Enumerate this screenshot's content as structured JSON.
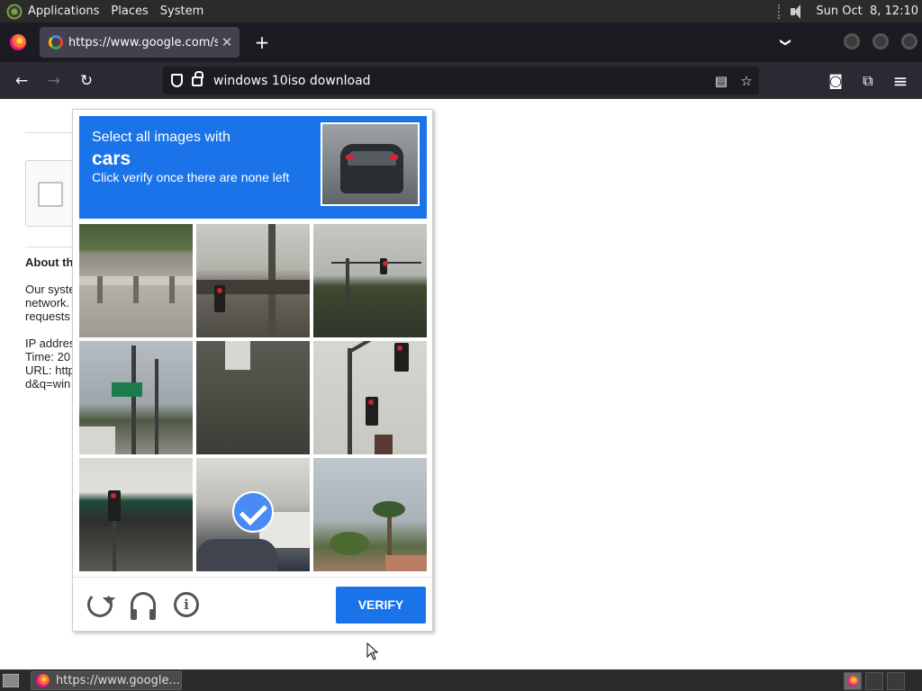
{
  "top_panel": {
    "menus": [
      "Applications",
      "Places",
      "System"
    ],
    "clock": "Sun Oct  8, 12:10"
  },
  "browser": {
    "tab_title": "https://www.google.com/se",
    "tab_close": "✕",
    "new_tab": "+",
    "tab_list": "❯",
    "url": "windows 10iso download",
    "icons": {
      "back": "←",
      "forward": "→",
      "reload": "↻",
      "reader": "▤",
      "star": "☆",
      "pocket": "◙",
      "extensions": "⧉",
      "menu": "≡"
    }
  },
  "page": {
    "about_heading": "About th",
    "body_lines": [
      "Our syste",
      "network.",
      "requests"
    ],
    "ip_line": "IP addres",
    "time_line": "Time: 20",
    "url_line": "URL: http",
    "url_line2": "d&q=win"
  },
  "captcha": {
    "instruction": "Select all images with",
    "target": "cars",
    "sub_instruction": "Click verify once there are none left",
    "selected_tiles": [
      7
    ],
    "info_glyph": "i",
    "verify_label": "VERIFY",
    "colors": {
      "accent": "#1a73e8",
      "check": "#4a8af4"
    }
  },
  "taskbar": {
    "task_label": "https://www.google..."
  }
}
